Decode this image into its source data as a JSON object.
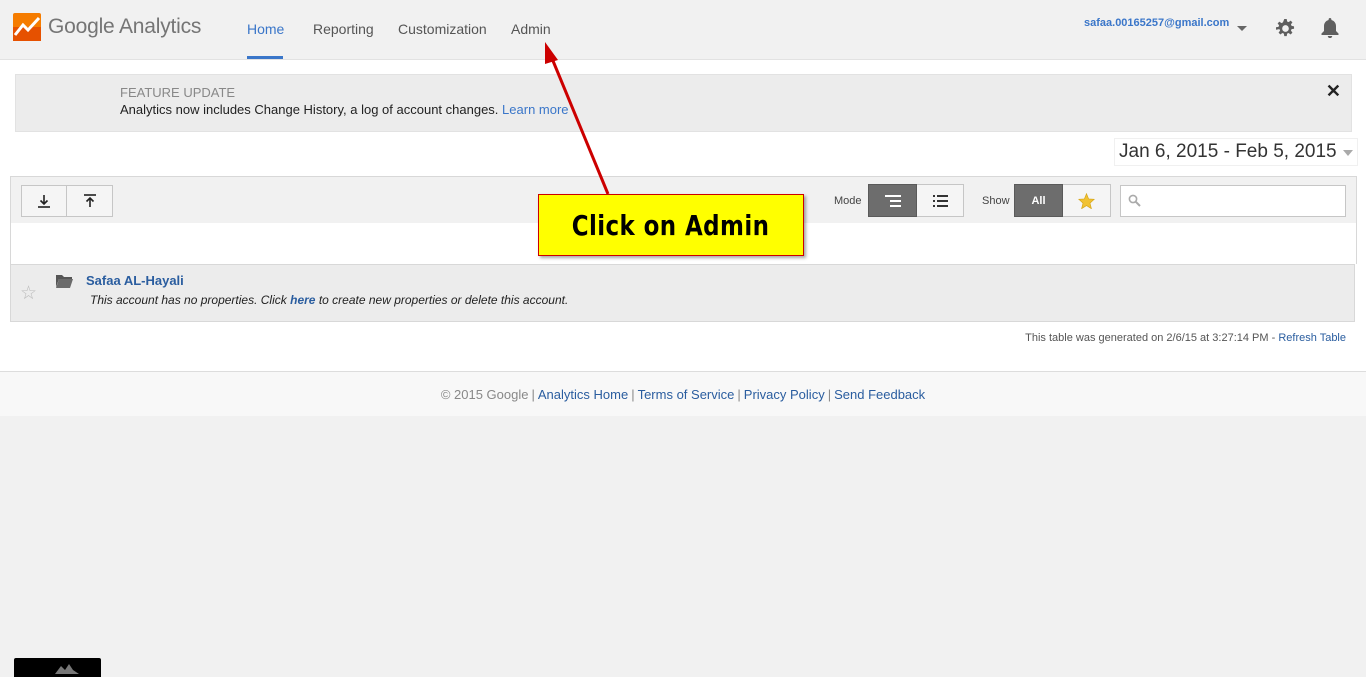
{
  "header": {
    "logo_text": "Google Analytics",
    "nav": [
      {
        "label": "Home",
        "active": true
      },
      {
        "label": "Reporting",
        "active": false
      },
      {
        "label": "Customization",
        "active": false
      },
      {
        "label": "Admin",
        "active": false
      }
    ],
    "account_email": "safaa.00165257@gmail.com",
    "icons": [
      "settings-gear-icon",
      "notifications-bell-icon"
    ]
  },
  "banner": {
    "kicker": "FEATURE UPDATE",
    "text": "Analytics now includes Change History, a log of account changes.",
    "link": "Learn more",
    "close": "✕"
  },
  "date_range": "Jan 6, 2015 - Feb 5, 2015",
  "toolbar": {
    "mode_label": "Mode",
    "show_label": "Show",
    "show_all_label": "All",
    "search_placeholder": ""
  },
  "accounts": [
    {
      "name": "Safaa AL-Hayali",
      "desc_before": "This account has no properties. Click",
      "desc_link": "here",
      "desc_after": "to create new properties or delete this account."
    }
  ],
  "generated": {
    "text": "This table was generated on 2/6/15 at 3:27:14 PM -",
    "link": "Refresh Table"
  },
  "footer": {
    "copyright": "© 2015 Google",
    "links": [
      "Analytics Home",
      "Terms of Service",
      "Privacy Policy",
      "Send Feedback"
    ]
  },
  "annotation": {
    "text": "Click on Admin",
    "colors": {
      "fill": "#ffff00",
      "arrow": "#cc0000"
    }
  },
  "colors": {
    "accent": "#3a76c9",
    "link": "#2a5d9f",
    "logo_orange": "#f57c00"
  }
}
